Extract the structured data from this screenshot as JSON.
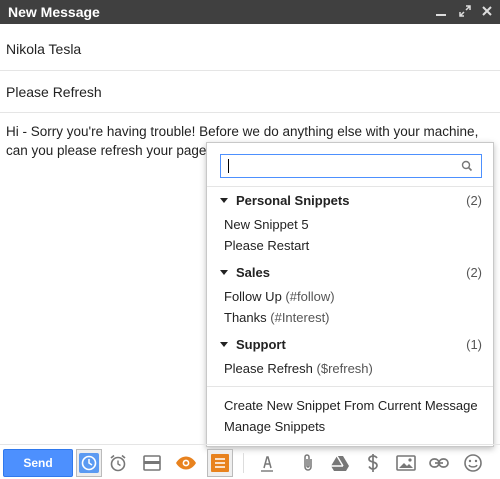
{
  "window": {
    "title": "New Message"
  },
  "compose": {
    "to": "Nikola Tesla",
    "subject": "Please Refresh",
    "body": "Hi - Sorry you're having trouble! Before we do anything else with your machine, can you please refresh your page?"
  },
  "snippets": {
    "search_value": "",
    "sections": [
      {
        "name": "Personal Snippets",
        "count": "(2)",
        "items": [
          {
            "label": "New Snippet 5",
            "shortcut": ""
          },
          {
            "label": "Please Restart",
            "shortcut": ""
          }
        ]
      },
      {
        "name": "Sales",
        "count": "(2)",
        "items": [
          {
            "label": "Follow Up",
            "shortcut": "(#follow)"
          },
          {
            "label": "Thanks",
            "shortcut": "(#Interest)"
          }
        ]
      },
      {
        "name": "Support",
        "count": "(1)",
        "items": [
          {
            "label": "Please Refresh",
            "shortcut": "($refresh)"
          }
        ]
      }
    ],
    "actions": {
      "create": "Create New Snippet From Current Message",
      "manage": "Manage Snippets"
    }
  },
  "toolbar": {
    "send_label": "Send"
  },
  "colors": {
    "titlebar": "#404040",
    "send": "#4d90fe",
    "accent": "#4d90fe",
    "orange": "#e8821e"
  }
}
